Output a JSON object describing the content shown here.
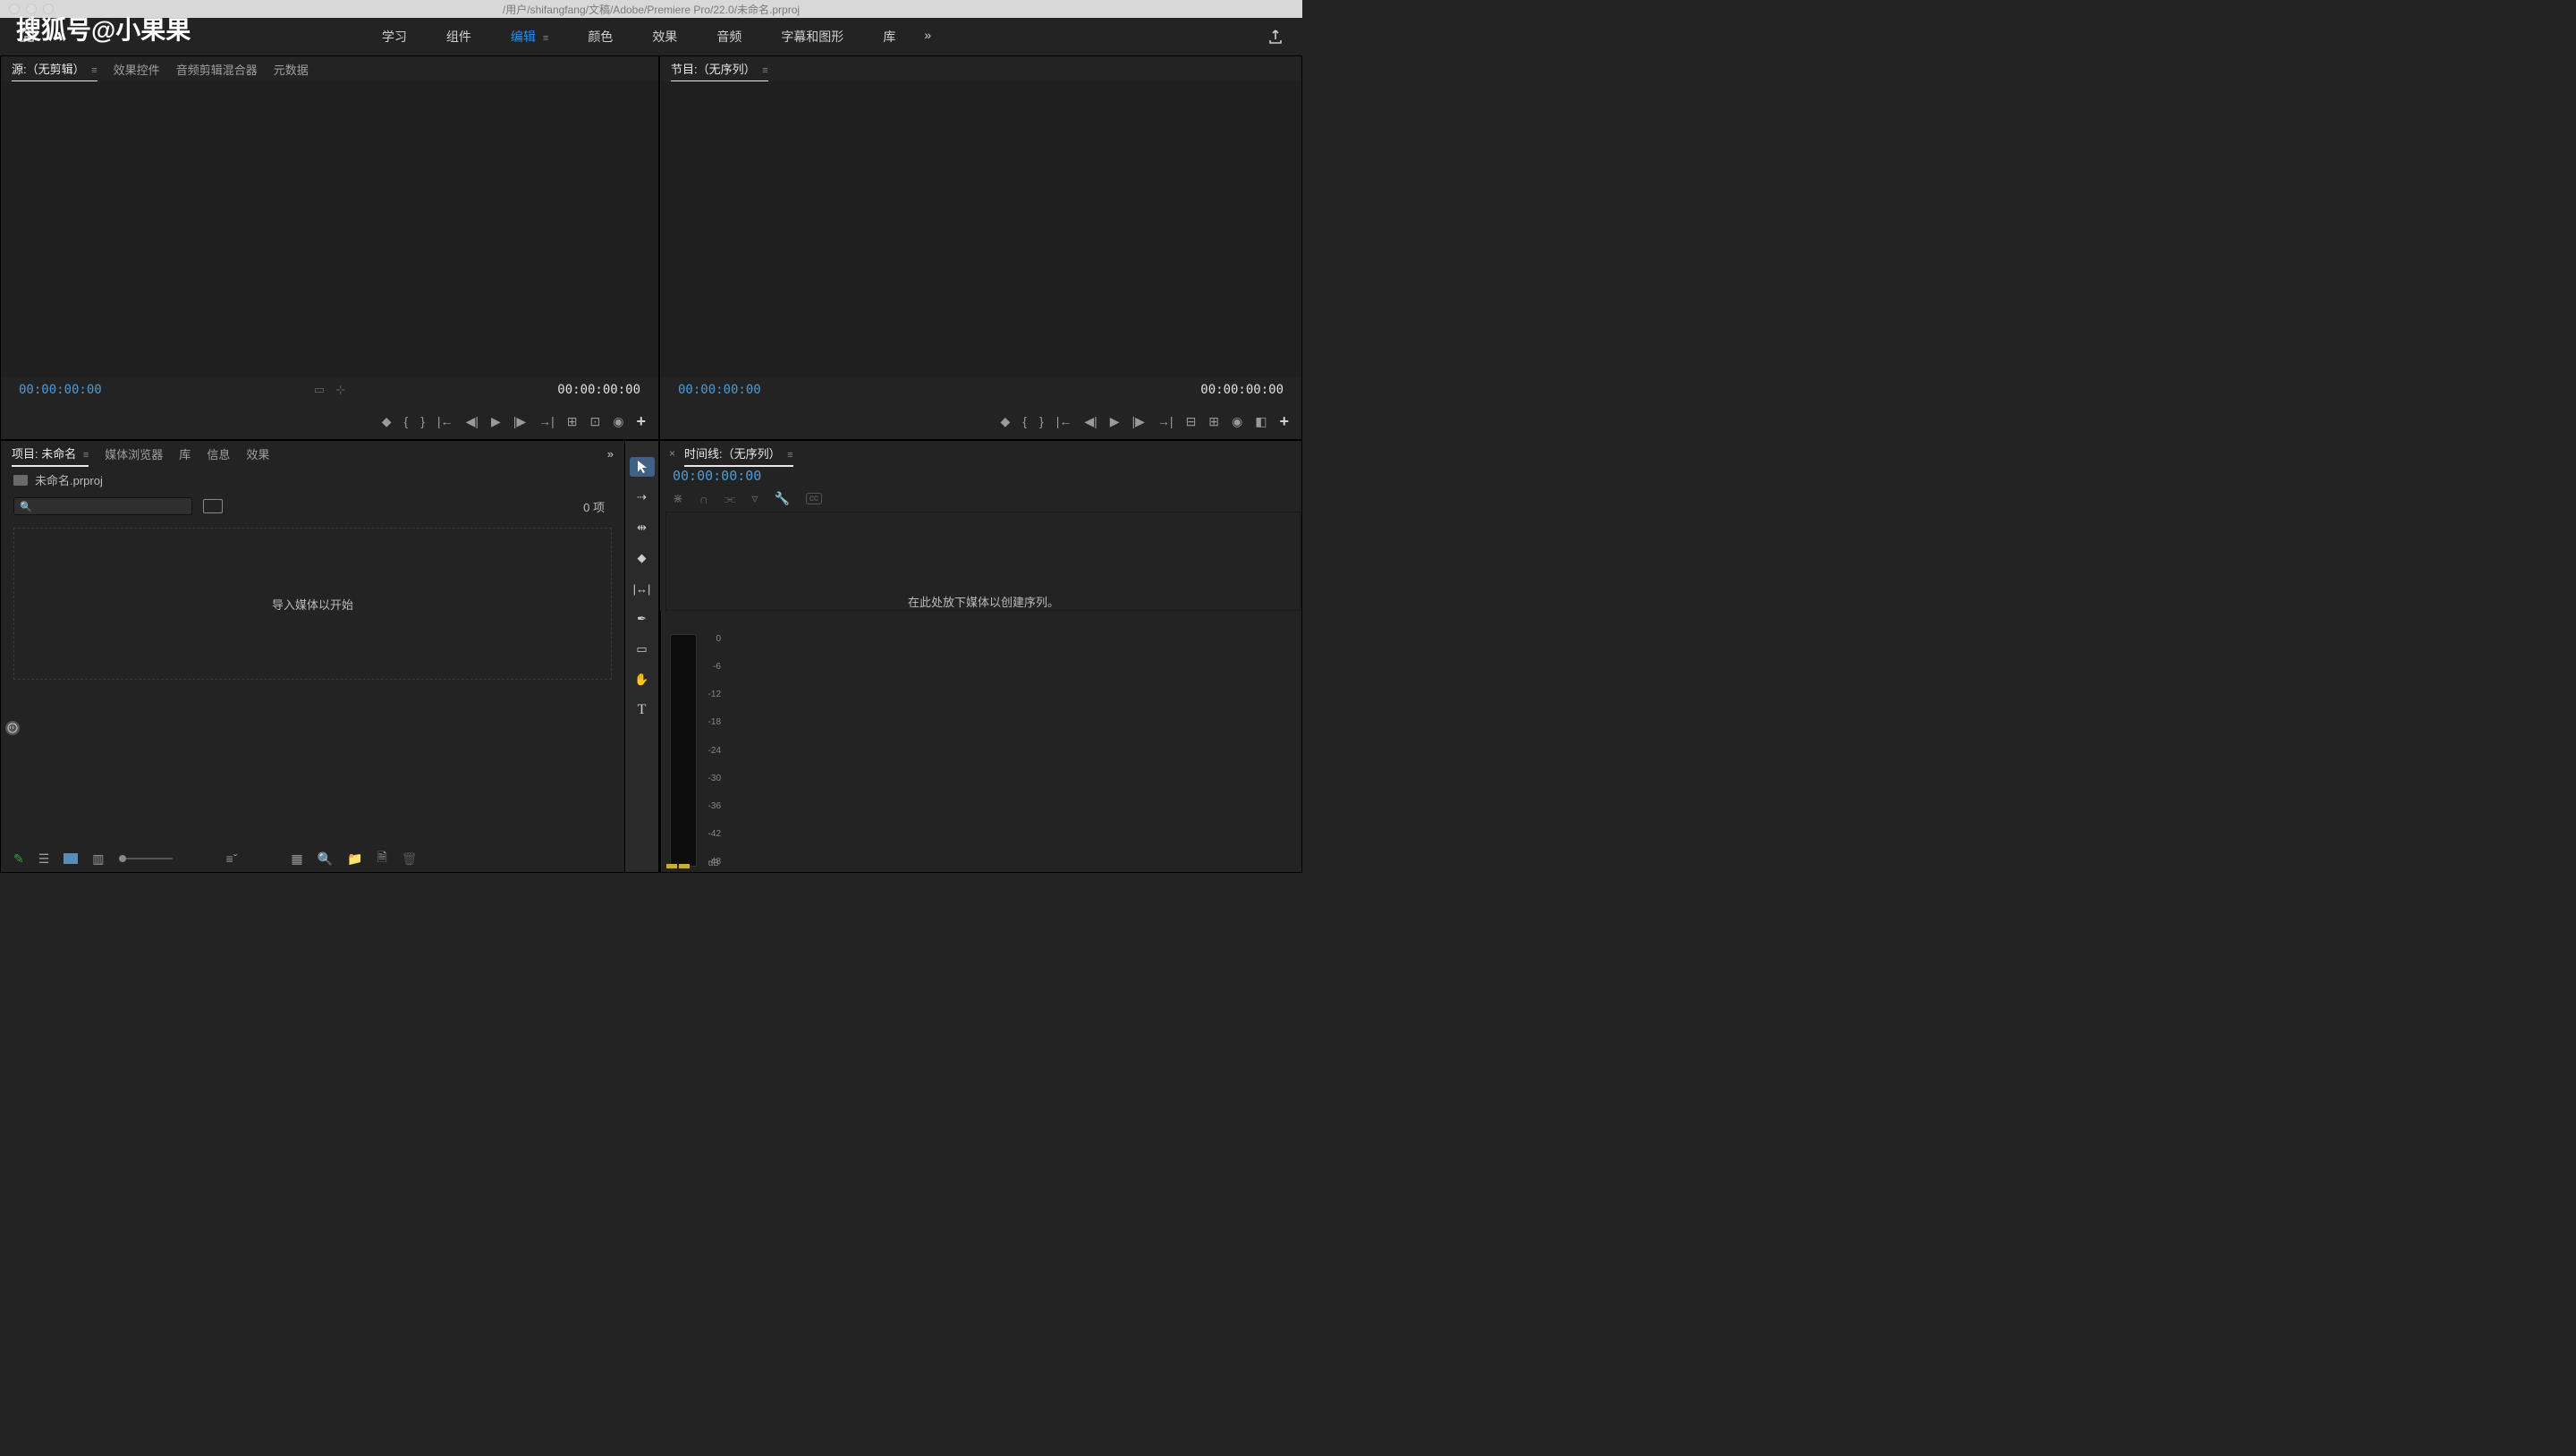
{
  "titlebar": {
    "path": "/用户/shifangfang/文稿/Adobe/Premiere Pro/22.0/未命名.prproj"
  },
  "watermark": "搜狐号@小果果",
  "workspaces": {
    "items": [
      {
        "label": "学习",
        "active": false
      },
      {
        "label": "组件",
        "active": false
      },
      {
        "label": "编辑",
        "active": true
      },
      {
        "label": "颜色",
        "active": false
      },
      {
        "label": "效果",
        "active": false
      },
      {
        "label": "音频",
        "active": false
      },
      {
        "label": "字幕和图形",
        "active": false
      },
      {
        "label": "库",
        "active": false
      }
    ],
    "overflow": "»"
  },
  "source_panel": {
    "tabs": [
      {
        "label": "源:（无剪辑）",
        "active": true
      },
      {
        "label": "效果控件",
        "active": false
      },
      {
        "label": "音频剪辑混合器",
        "active": false
      },
      {
        "label": "元数据",
        "active": false
      }
    ],
    "tc_left": "00:00:00:00",
    "tc_right": "00:00:00:00"
  },
  "program_panel": {
    "tab_label": "节目:（无序列）",
    "tc_left": "00:00:00:00",
    "tc_right": "00:00:00:00"
  },
  "project_panel": {
    "tabs": [
      {
        "label": "项目: 未命名",
        "active": true
      },
      {
        "label": "媒体浏览器",
        "active": false
      },
      {
        "label": "库",
        "active": false
      },
      {
        "label": "信息",
        "active": false
      },
      {
        "label": "效果",
        "active": false
      }
    ],
    "overflow": "»",
    "filename": "未命名.prproj",
    "item_count": "0 项",
    "drop_hint": "导入媒体以开始"
  },
  "timeline_panel": {
    "tab_label": "时间线:（无序列）",
    "timecode": "00:00:00:00",
    "drop_hint": "在此处放下媒体以创建序列。"
  },
  "audio_meter": {
    "ticks": [
      "0",
      "-6",
      "-12",
      "-18",
      "-24",
      "-30",
      "-36",
      "-42",
      "-48"
    ],
    "unit": "dB"
  },
  "icons": {
    "play": "▶",
    "step_back": "◀|",
    "step_fwd": "|▶",
    "in": "{",
    "out": "}",
    "goto_in": "|←",
    "goto_out": "→|",
    "marker": "◆",
    "insert": "⊞",
    "overwrite": "⊡",
    "export_frame": "📷",
    "plus": "+",
    "magnet": "∩",
    "wrench": "🔧",
    "cc": "cc",
    "link": "⫘",
    "marker2": "▿"
  }
}
